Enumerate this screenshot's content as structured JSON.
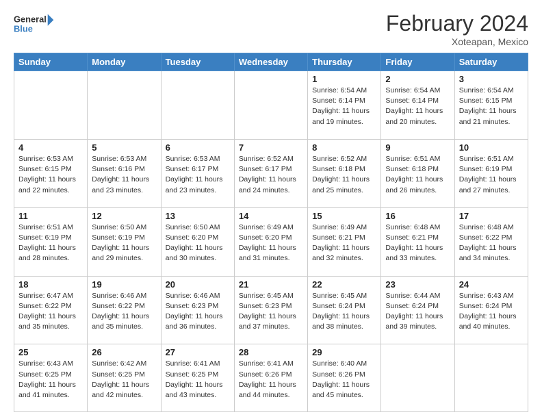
{
  "logo": {
    "line1": "General",
    "line2": "Blue"
  },
  "header": {
    "month_year": "February 2024",
    "location": "Xoteapan, Mexico"
  },
  "weekdays": [
    "Sunday",
    "Monday",
    "Tuesday",
    "Wednesday",
    "Thursday",
    "Friday",
    "Saturday"
  ],
  "weeks": [
    [
      {
        "day": "",
        "info": ""
      },
      {
        "day": "",
        "info": ""
      },
      {
        "day": "",
        "info": ""
      },
      {
        "day": "",
        "info": ""
      },
      {
        "day": "1",
        "info": "Sunrise: 6:54 AM\nSunset: 6:14 PM\nDaylight: 11 hours\nand 19 minutes."
      },
      {
        "day": "2",
        "info": "Sunrise: 6:54 AM\nSunset: 6:14 PM\nDaylight: 11 hours\nand 20 minutes."
      },
      {
        "day": "3",
        "info": "Sunrise: 6:54 AM\nSunset: 6:15 PM\nDaylight: 11 hours\nand 21 minutes."
      }
    ],
    [
      {
        "day": "4",
        "info": "Sunrise: 6:53 AM\nSunset: 6:15 PM\nDaylight: 11 hours\nand 22 minutes."
      },
      {
        "day": "5",
        "info": "Sunrise: 6:53 AM\nSunset: 6:16 PM\nDaylight: 11 hours\nand 23 minutes."
      },
      {
        "day": "6",
        "info": "Sunrise: 6:53 AM\nSunset: 6:17 PM\nDaylight: 11 hours\nand 23 minutes."
      },
      {
        "day": "7",
        "info": "Sunrise: 6:52 AM\nSunset: 6:17 PM\nDaylight: 11 hours\nand 24 minutes."
      },
      {
        "day": "8",
        "info": "Sunrise: 6:52 AM\nSunset: 6:18 PM\nDaylight: 11 hours\nand 25 minutes."
      },
      {
        "day": "9",
        "info": "Sunrise: 6:51 AM\nSunset: 6:18 PM\nDaylight: 11 hours\nand 26 minutes."
      },
      {
        "day": "10",
        "info": "Sunrise: 6:51 AM\nSunset: 6:19 PM\nDaylight: 11 hours\nand 27 minutes."
      }
    ],
    [
      {
        "day": "11",
        "info": "Sunrise: 6:51 AM\nSunset: 6:19 PM\nDaylight: 11 hours\nand 28 minutes."
      },
      {
        "day": "12",
        "info": "Sunrise: 6:50 AM\nSunset: 6:19 PM\nDaylight: 11 hours\nand 29 minutes."
      },
      {
        "day": "13",
        "info": "Sunrise: 6:50 AM\nSunset: 6:20 PM\nDaylight: 11 hours\nand 30 minutes."
      },
      {
        "day": "14",
        "info": "Sunrise: 6:49 AM\nSunset: 6:20 PM\nDaylight: 11 hours\nand 31 minutes."
      },
      {
        "day": "15",
        "info": "Sunrise: 6:49 AM\nSunset: 6:21 PM\nDaylight: 11 hours\nand 32 minutes."
      },
      {
        "day": "16",
        "info": "Sunrise: 6:48 AM\nSunset: 6:21 PM\nDaylight: 11 hours\nand 33 minutes."
      },
      {
        "day": "17",
        "info": "Sunrise: 6:48 AM\nSunset: 6:22 PM\nDaylight: 11 hours\nand 34 minutes."
      }
    ],
    [
      {
        "day": "18",
        "info": "Sunrise: 6:47 AM\nSunset: 6:22 PM\nDaylight: 11 hours\nand 35 minutes."
      },
      {
        "day": "19",
        "info": "Sunrise: 6:46 AM\nSunset: 6:22 PM\nDaylight: 11 hours\nand 35 minutes."
      },
      {
        "day": "20",
        "info": "Sunrise: 6:46 AM\nSunset: 6:23 PM\nDaylight: 11 hours\nand 36 minutes."
      },
      {
        "day": "21",
        "info": "Sunrise: 6:45 AM\nSunset: 6:23 PM\nDaylight: 11 hours\nand 37 minutes."
      },
      {
        "day": "22",
        "info": "Sunrise: 6:45 AM\nSunset: 6:24 PM\nDaylight: 11 hours\nand 38 minutes."
      },
      {
        "day": "23",
        "info": "Sunrise: 6:44 AM\nSunset: 6:24 PM\nDaylight: 11 hours\nand 39 minutes."
      },
      {
        "day": "24",
        "info": "Sunrise: 6:43 AM\nSunset: 6:24 PM\nDaylight: 11 hours\nand 40 minutes."
      }
    ],
    [
      {
        "day": "25",
        "info": "Sunrise: 6:43 AM\nSunset: 6:25 PM\nDaylight: 11 hours\nand 41 minutes."
      },
      {
        "day": "26",
        "info": "Sunrise: 6:42 AM\nSunset: 6:25 PM\nDaylight: 11 hours\nand 42 minutes."
      },
      {
        "day": "27",
        "info": "Sunrise: 6:41 AM\nSunset: 6:25 PM\nDaylight: 11 hours\nand 43 minutes."
      },
      {
        "day": "28",
        "info": "Sunrise: 6:41 AM\nSunset: 6:26 PM\nDaylight: 11 hours\nand 44 minutes."
      },
      {
        "day": "29",
        "info": "Sunrise: 6:40 AM\nSunset: 6:26 PM\nDaylight: 11 hours\nand 45 minutes."
      },
      {
        "day": "",
        "info": ""
      },
      {
        "day": "",
        "info": ""
      }
    ]
  ]
}
